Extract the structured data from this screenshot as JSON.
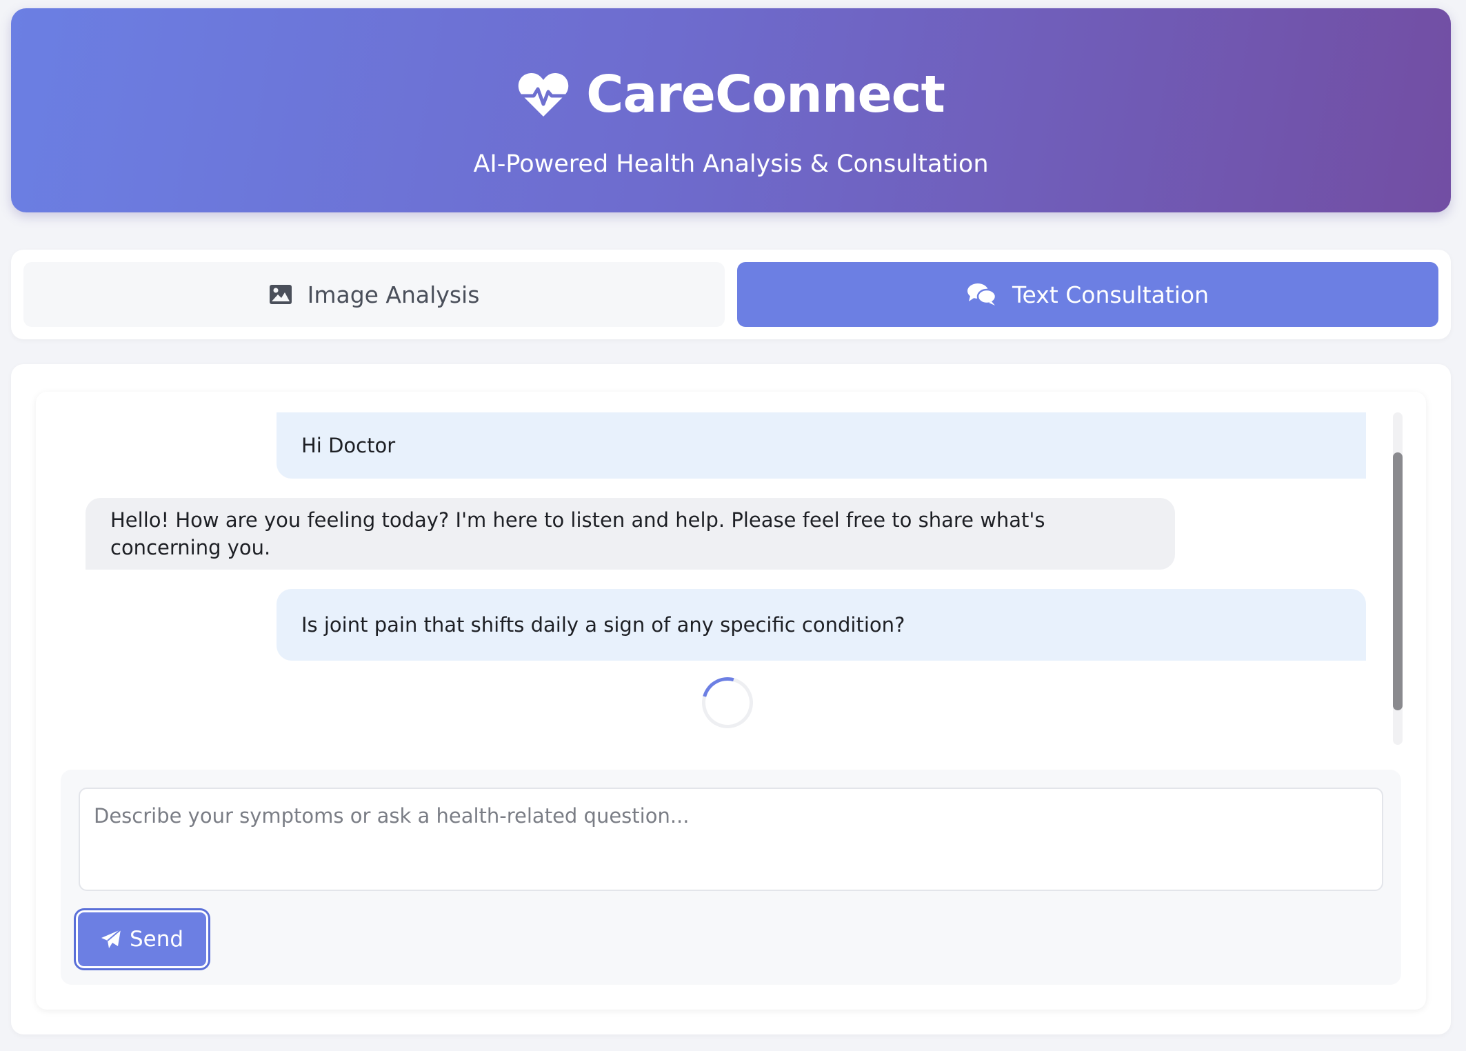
{
  "header": {
    "title": "CareConnect",
    "tagline": "AI-Powered Health Analysis & Consultation",
    "logo_icon": "heart-pulse-icon"
  },
  "tabs": [
    {
      "label": "Image Analysis",
      "icon": "image-icon",
      "active": false
    },
    {
      "label": "Text Consultation",
      "icon": "comments-icon",
      "active": true
    }
  ],
  "chat": {
    "messages": [
      {
        "role": "user",
        "text": "Hi Doctor"
      },
      {
        "role": "assistant",
        "text": "Hello! How are you feeling today? I'm here to listen and help. Please feel free to share what's concerning you."
      },
      {
        "role": "user",
        "text": "Is joint pain that shifts daily a sign of any specific condition?"
      }
    ],
    "loading": true
  },
  "input": {
    "value": "",
    "placeholder": "Describe your symptoms or ask a health-related question..."
  },
  "send_button": {
    "label": "Send",
    "icon": "paper-plane-icon"
  },
  "colors": {
    "accent": "#6c7fe3",
    "header_gradient_start": "#6b7fe3",
    "header_gradient_end": "#724ea3",
    "user_bubble": "#e8f1fc",
    "assistant_bubble": "#eff0f3"
  }
}
